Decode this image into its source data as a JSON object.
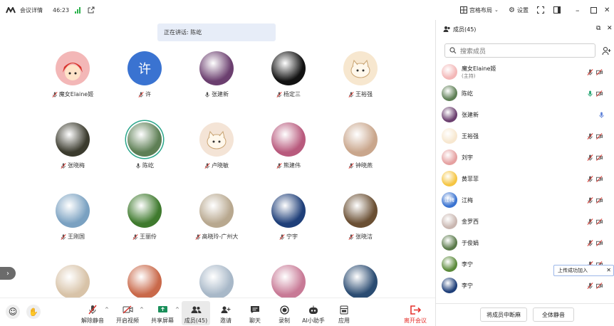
{
  "topbar": {
    "app_name": "会议详情",
    "timer": "46:23"
  },
  "speaking": "正在讲话: 陈屹",
  "header_right": {
    "layout_label": "宫格布局",
    "settings_label": "设置"
  },
  "grid": [
    {
      "name": "魔女Elaine姬",
      "mic": "off",
      "avatar": {
        "type": "cartoon-girl",
        "color": "#f3b7b7"
      }
    },
    {
      "name": "许",
      "mic": "off",
      "avatar": {
        "type": "letter",
        "text": "许",
        "color": "#3a73d1"
      }
    },
    {
      "name": "张建新",
      "mic": "on",
      "avatar": {
        "type": "photo",
        "color": "#6b3f6f"
      }
    },
    {
      "name": "杨定三",
      "mic": "off",
      "avatar": {
        "type": "photo",
        "color": "#121212"
      }
    },
    {
      "name": "王裕强",
      "mic": "off",
      "avatar": {
        "type": "cartoon-cat",
        "color": "#f7e7cf"
      }
    },
    {
      "name": "张晓梅",
      "mic": "off",
      "avatar": {
        "type": "photo",
        "color": "#3b3b2e"
      }
    },
    {
      "name": "陈屹",
      "mic": "on",
      "avatar": {
        "type": "photo",
        "color": "#5e7f55"
      },
      "speaking": true
    },
    {
      "name": "卢晓敏",
      "mic": "off",
      "avatar": {
        "type": "cartoon-cat",
        "color": "#f4e4d6"
      }
    },
    {
      "name": "熊建伟",
      "mic": "off",
      "avatar": {
        "type": "photo",
        "color": "#b85a7d"
      }
    },
    {
      "name": "钟晓燕",
      "mic": "off",
      "avatar": {
        "type": "photo",
        "color": "#c9a68c"
      }
    },
    {
      "name": "王刚国",
      "mic": "off",
      "avatar": {
        "type": "photo",
        "color": "#7aa1c1"
      }
    },
    {
      "name": "王丽伶",
      "mic": "off",
      "avatar": {
        "type": "photo",
        "color": "#3f7a2e"
      }
    },
    {
      "name": "高晓玲-广州大",
      "mic": "off",
      "avatar": {
        "type": "photo",
        "color": "#b8a88f"
      }
    },
    {
      "name": "宁宇",
      "mic": "off",
      "avatar": {
        "type": "photo",
        "color": "#1f3f79"
      }
    },
    {
      "name": "张晓洁",
      "mic": "off",
      "avatar": {
        "type": "photo",
        "color": "#6a4f33"
      }
    },
    {
      "name": "",
      "mic": "none",
      "avatar": {
        "type": "photo",
        "color": "#d8c3a8"
      }
    },
    {
      "name": "",
      "mic": "none",
      "avatar": {
        "type": "photo",
        "color": "#c9694a"
      }
    },
    {
      "name": "",
      "mic": "none",
      "avatar": {
        "type": "photo",
        "color": "#a8b8c8"
      }
    },
    {
      "name": "",
      "mic": "none",
      "avatar": {
        "type": "photo",
        "color": "#c87a96"
      }
    },
    {
      "name": "",
      "mic": "none",
      "avatar": {
        "type": "photo",
        "color": "#2b4c72"
      }
    }
  ],
  "toolbar": {
    "unmute": "解除静音",
    "video": "开启视频",
    "share": "共享屏幕",
    "members": "成员(45)",
    "invite": "邀请",
    "chat": "聊天",
    "record": "录制",
    "ai": "AI小助手",
    "apps": "应用",
    "leave": "离开会议"
  },
  "panel": {
    "title": "成员(45)",
    "search_placeholder": "搜索成员",
    "members": [
      {
        "name": "魔女Elaine姬",
        "sub": "(主持)",
        "mic": "off",
        "avatar_color": "#f3b7b7"
      },
      {
        "name": "陈屹",
        "mic": "on",
        "avatar_color": "#5e7f55"
      },
      {
        "name": "张建新",
        "mic": "active",
        "avatar_color": "#6b3f6f"
      },
      {
        "name": "王裕强",
        "mic": "off",
        "avatar_color": "#f7e7cf"
      },
      {
        "name": "刘宇",
        "mic": "off",
        "avatar_color": "#e5a0a0"
      },
      {
        "name": "黄菲菲",
        "mic": "off",
        "avatar_color": "#f5c542"
      },
      {
        "name": "江梅",
        "mic": "off",
        "avatar_color": "#3a73d1",
        "avatar_text": "江梅"
      },
      {
        "name": "金罗西",
        "mic": "off",
        "avatar_color": "#c9b6b0"
      },
      {
        "name": "于俊娟",
        "mic": "off",
        "avatar_color": "#5a7a4a"
      },
      {
        "name": "李宁",
        "mic": "off",
        "avatar_color": "#5b8a3a"
      },
      {
        "name": "李宁",
        "mic": "off",
        "avatar_color": "#1f3f79"
      }
    ],
    "footer": {
      "mute_on_join": "将成员中断麻",
      "mute_all": "全体静音"
    }
  },
  "toast": "上传成功加入"
}
